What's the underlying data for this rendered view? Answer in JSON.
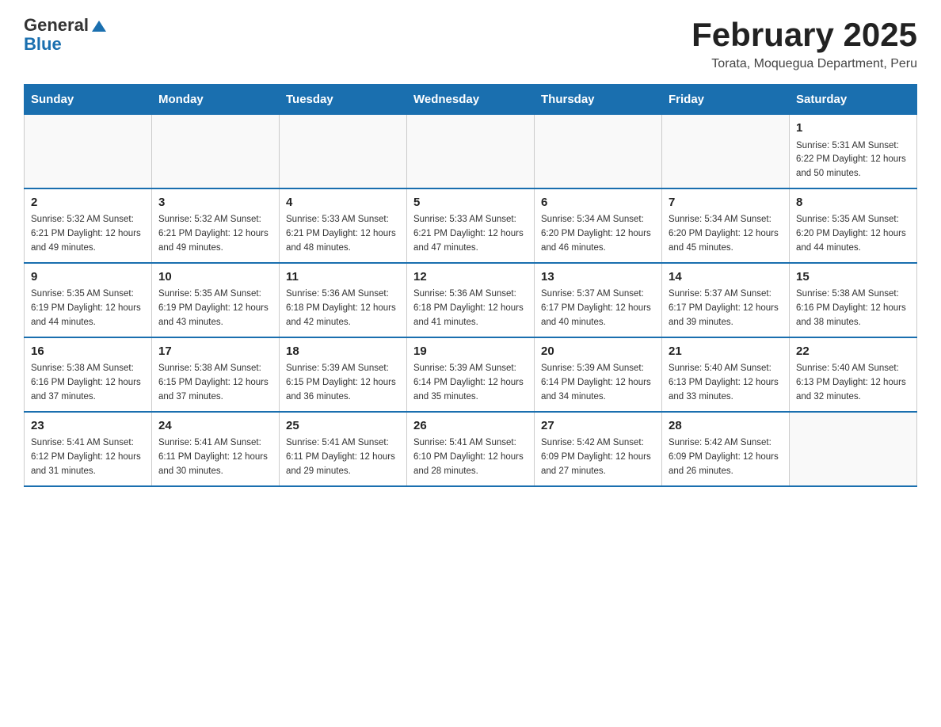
{
  "header": {
    "logo_general": "General",
    "logo_blue": "Blue",
    "title": "February 2025",
    "subtitle": "Torata, Moquegua Department, Peru"
  },
  "days_of_week": [
    "Sunday",
    "Monday",
    "Tuesday",
    "Wednesday",
    "Thursday",
    "Friday",
    "Saturday"
  ],
  "weeks": [
    [
      {
        "day": "",
        "info": ""
      },
      {
        "day": "",
        "info": ""
      },
      {
        "day": "",
        "info": ""
      },
      {
        "day": "",
        "info": ""
      },
      {
        "day": "",
        "info": ""
      },
      {
        "day": "",
        "info": ""
      },
      {
        "day": "1",
        "info": "Sunrise: 5:31 AM\nSunset: 6:22 PM\nDaylight: 12 hours and 50 minutes."
      }
    ],
    [
      {
        "day": "2",
        "info": "Sunrise: 5:32 AM\nSunset: 6:21 PM\nDaylight: 12 hours and 49 minutes."
      },
      {
        "day": "3",
        "info": "Sunrise: 5:32 AM\nSunset: 6:21 PM\nDaylight: 12 hours and 49 minutes."
      },
      {
        "day": "4",
        "info": "Sunrise: 5:33 AM\nSunset: 6:21 PM\nDaylight: 12 hours and 48 minutes."
      },
      {
        "day": "5",
        "info": "Sunrise: 5:33 AM\nSunset: 6:21 PM\nDaylight: 12 hours and 47 minutes."
      },
      {
        "day": "6",
        "info": "Sunrise: 5:34 AM\nSunset: 6:20 PM\nDaylight: 12 hours and 46 minutes."
      },
      {
        "day": "7",
        "info": "Sunrise: 5:34 AM\nSunset: 6:20 PM\nDaylight: 12 hours and 45 minutes."
      },
      {
        "day": "8",
        "info": "Sunrise: 5:35 AM\nSunset: 6:20 PM\nDaylight: 12 hours and 44 minutes."
      }
    ],
    [
      {
        "day": "9",
        "info": "Sunrise: 5:35 AM\nSunset: 6:19 PM\nDaylight: 12 hours and 44 minutes."
      },
      {
        "day": "10",
        "info": "Sunrise: 5:35 AM\nSunset: 6:19 PM\nDaylight: 12 hours and 43 minutes."
      },
      {
        "day": "11",
        "info": "Sunrise: 5:36 AM\nSunset: 6:18 PM\nDaylight: 12 hours and 42 minutes."
      },
      {
        "day": "12",
        "info": "Sunrise: 5:36 AM\nSunset: 6:18 PM\nDaylight: 12 hours and 41 minutes."
      },
      {
        "day": "13",
        "info": "Sunrise: 5:37 AM\nSunset: 6:17 PM\nDaylight: 12 hours and 40 minutes."
      },
      {
        "day": "14",
        "info": "Sunrise: 5:37 AM\nSunset: 6:17 PM\nDaylight: 12 hours and 39 minutes."
      },
      {
        "day": "15",
        "info": "Sunrise: 5:38 AM\nSunset: 6:16 PM\nDaylight: 12 hours and 38 minutes."
      }
    ],
    [
      {
        "day": "16",
        "info": "Sunrise: 5:38 AM\nSunset: 6:16 PM\nDaylight: 12 hours and 37 minutes."
      },
      {
        "day": "17",
        "info": "Sunrise: 5:38 AM\nSunset: 6:15 PM\nDaylight: 12 hours and 37 minutes."
      },
      {
        "day": "18",
        "info": "Sunrise: 5:39 AM\nSunset: 6:15 PM\nDaylight: 12 hours and 36 minutes."
      },
      {
        "day": "19",
        "info": "Sunrise: 5:39 AM\nSunset: 6:14 PM\nDaylight: 12 hours and 35 minutes."
      },
      {
        "day": "20",
        "info": "Sunrise: 5:39 AM\nSunset: 6:14 PM\nDaylight: 12 hours and 34 minutes."
      },
      {
        "day": "21",
        "info": "Sunrise: 5:40 AM\nSunset: 6:13 PM\nDaylight: 12 hours and 33 minutes."
      },
      {
        "day": "22",
        "info": "Sunrise: 5:40 AM\nSunset: 6:13 PM\nDaylight: 12 hours and 32 minutes."
      }
    ],
    [
      {
        "day": "23",
        "info": "Sunrise: 5:41 AM\nSunset: 6:12 PM\nDaylight: 12 hours and 31 minutes."
      },
      {
        "day": "24",
        "info": "Sunrise: 5:41 AM\nSunset: 6:11 PM\nDaylight: 12 hours and 30 minutes."
      },
      {
        "day": "25",
        "info": "Sunrise: 5:41 AM\nSunset: 6:11 PM\nDaylight: 12 hours and 29 minutes."
      },
      {
        "day": "26",
        "info": "Sunrise: 5:41 AM\nSunset: 6:10 PM\nDaylight: 12 hours and 28 minutes."
      },
      {
        "day": "27",
        "info": "Sunrise: 5:42 AM\nSunset: 6:09 PM\nDaylight: 12 hours and 27 minutes."
      },
      {
        "day": "28",
        "info": "Sunrise: 5:42 AM\nSunset: 6:09 PM\nDaylight: 12 hours and 26 minutes."
      },
      {
        "day": "",
        "info": ""
      }
    ]
  ]
}
